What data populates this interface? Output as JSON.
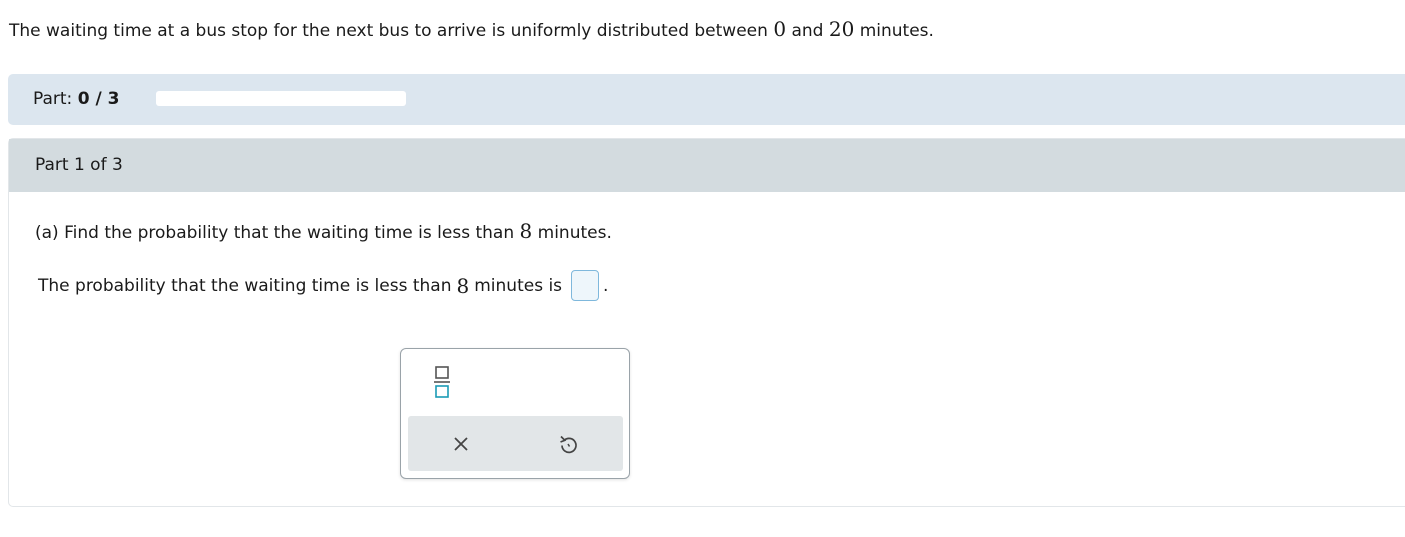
{
  "intro": {
    "text_before": "The waiting time at a bus stop for the next bus to arrive is uniformly distributed between ",
    "lower": "0",
    "text_middle": " and ",
    "upper": "20",
    "text_after": " minutes."
  },
  "progress": {
    "label": "Part:",
    "value": "0 / 3",
    "fraction_complete": 0
  },
  "part_header": "Part 1 of 3",
  "question": {
    "text_before": "(a) Find the probability that the waiting time is less than ",
    "value": "8",
    "text_after": " minutes."
  },
  "answer": {
    "text_before": "The probability that the waiting time is less than ",
    "value": "8",
    "text_after": " minutes is",
    "current_value": "",
    "period": "."
  },
  "palette": {
    "fraction_icon": "fraction-icon",
    "clear_icon": "close-icon",
    "undo_icon": "undo-icon",
    "accent_color": "#1b9bb5"
  }
}
